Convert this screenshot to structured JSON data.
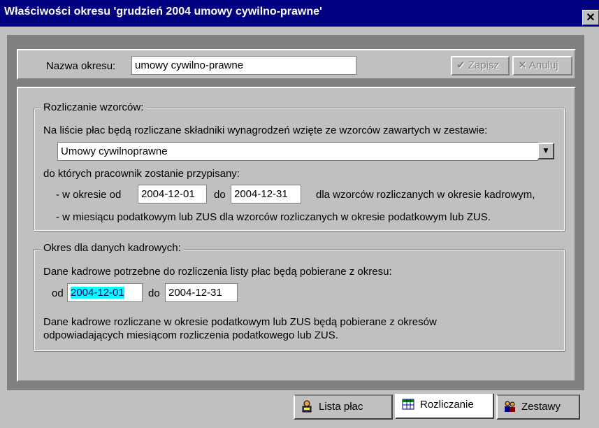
{
  "window": {
    "title": "Właściwości okresu 'grudzień 2004 umowy cywilno-prawne'",
    "close_glyph": "✕"
  },
  "header": {
    "name_label": "Nazwa okresu:",
    "name_value": "umowy cywilno-prawne",
    "save_label": "Zapisz",
    "cancel_label": "Anuluj",
    "save_icon": "check-icon",
    "cancel_icon": "x-icon"
  },
  "rozliczanie": {
    "legend": "Rozliczanie wzorców:",
    "intro": "Na liście płac będą rozliczane składniki wynagrodzeń wzięte ze wzorców zawartych w zestawie:",
    "zestaw_value": "Umowy cywilnoprawne",
    "assign_text": "do których pracownik zostanie przypisany:",
    "period_prefix": "- w okresie od",
    "date_from": "2004-12-01",
    "to_label": "do",
    "date_to": "2004-12-31",
    "period_suffix": "dla wzorców rozliczanych w okresie kadrowym,",
    "tax_line": "- w miesiącu podatkowym lub ZUS dla wzorców rozliczanych w okresie podatkowym lub ZUS."
  },
  "kadrowe": {
    "legend": "Okres dla danych kadrowych:",
    "intro": "Dane kadrowe potrzebne do rozliczenia listy płac będą pobierane z okresu:",
    "from_label": "od",
    "date_from": "2004-12-01",
    "to_label": "do",
    "date_to": "2004-12-31",
    "note_line1": "Dane kadrowe rozliczane w okresie podatkowym lub ZUS będą pobierane z okresów",
    "note_line2": "odpowiadających miesiącom rozliczenia podatkowego lub ZUS."
  },
  "tabs": [
    {
      "label": "Lista płac",
      "icon": "person-icon",
      "active": false
    },
    {
      "label": "Rozliczanie",
      "icon": "spreadsheet-icon",
      "active": true
    },
    {
      "label": "Zestawy",
      "icon": "people-group-icon",
      "active": false
    }
  ],
  "colors": {
    "title_bar": "#000080",
    "face": "#c0c0c0",
    "highlight": "#00ffff"
  }
}
